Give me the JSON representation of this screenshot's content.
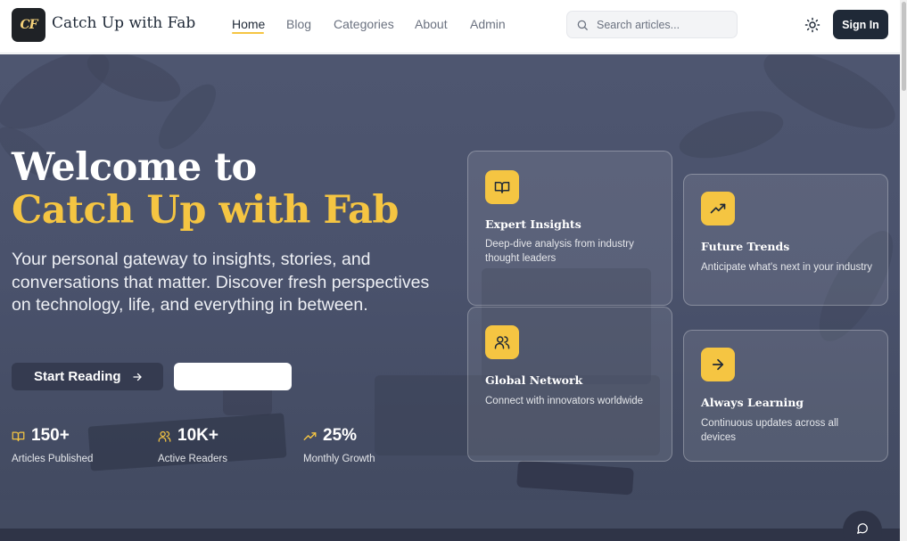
{
  "brand": {
    "logo_text": "CF",
    "name": "Catch Up with Fab"
  },
  "nav": {
    "items": [
      {
        "label": "Home",
        "active": true
      },
      {
        "label": "Blog",
        "active": false
      },
      {
        "label": "Categories",
        "active": false
      },
      {
        "label": "About",
        "active": false
      },
      {
        "label": "Admin",
        "active": false
      }
    ]
  },
  "search": {
    "placeholder": "Search articles...",
    "value": "",
    "icon": "search-icon"
  },
  "header_actions": {
    "theme_icon": "sun-icon",
    "signin_label": "Sign In"
  },
  "hero": {
    "title_line1": "Welcome to",
    "title_line2": "Catch Up with Fab",
    "description": "Your personal gateway to insights, stories, and conversations that matter. Discover fresh perspectives on technology, life, and everything in between.",
    "primary_button": "Start Reading",
    "secondary_button": ""
  },
  "stats": [
    {
      "icon": "book-open-icon",
      "value": "150+",
      "label": "Articles Published"
    },
    {
      "icon": "users-icon",
      "value": "10K+",
      "label": "Active Readers"
    },
    {
      "icon": "trending-up-icon",
      "value": "25%",
      "label": "Monthly Growth"
    }
  ],
  "features": [
    {
      "icon": "book-open-icon",
      "title": "Expert Insights",
      "description": "Deep-dive analysis from industry thought leaders"
    },
    {
      "icon": "trending-up-icon",
      "title": "Future Trends",
      "description": "Anticipate what's next in your industry"
    },
    {
      "icon": "users-icon",
      "title": "Global Network",
      "description": "Connect with innovators worldwide"
    },
    {
      "icon": "arrow-right-icon",
      "title": "Always Learning",
      "description": "Continuous updates across all devices"
    }
  ],
  "chat": {
    "icon": "chat-bubble-icon"
  },
  "colors": {
    "accent": "#f5c542",
    "dark": "#1f2937",
    "hero_overlay": "#4a526c",
    "text_light": "#e5e7eb"
  }
}
